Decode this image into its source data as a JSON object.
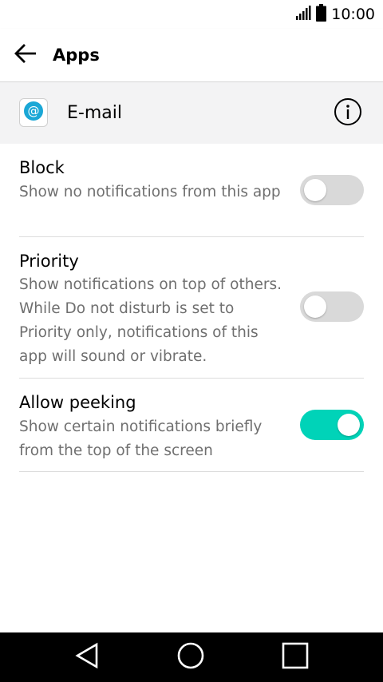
{
  "status_bar": {
    "time": "10:00",
    "icons": [
      "signal-icon",
      "battery-icon"
    ]
  },
  "app_bar": {
    "back_icon": "arrow-left-icon",
    "title": "Apps"
  },
  "app_header": {
    "icon": "email-at-icon",
    "name": "E-mail",
    "info_icon": "info-icon"
  },
  "settings": [
    {
      "title": "Block",
      "description": "Show no notifications from this app",
      "enabled": false
    },
    {
      "title": "Priority",
      "description": "Show notifications on top of others. While Do not disturb is set to Priority only, notifications of this app will sound or vibrate.",
      "enabled": false
    },
    {
      "title": "Allow peeking",
      "description": "Show certain notifications briefly from the top of the screen",
      "enabled": true
    }
  ],
  "colors": {
    "toggle_on": "#00d3b8",
    "toggle_off": "#d9d9d9",
    "email_icon": "#1aa7d6"
  },
  "nav_bar": {
    "icons": [
      "back-triangle-icon",
      "home-circle-icon",
      "recents-square-icon"
    ]
  }
}
